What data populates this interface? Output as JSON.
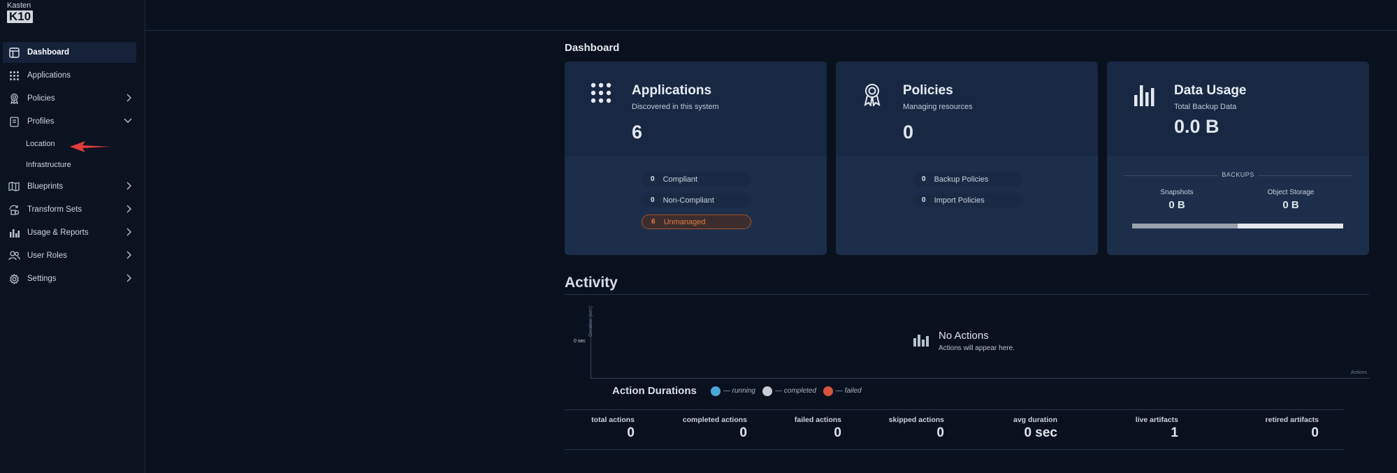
{
  "app": {
    "brand": "Kasten",
    "product": "K10"
  },
  "sidebar": {
    "items": [
      {
        "label": "Dashboard",
        "icon": "dashboard-icon",
        "active": true
      },
      {
        "label": "Applications",
        "icon": "grid-icon"
      },
      {
        "label": "Policies",
        "icon": "ribbon-icon",
        "chevron": "right"
      },
      {
        "label": "Profiles",
        "icon": "profile-icon",
        "chevron": "down"
      },
      {
        "label": "Blueprints",
        "icon": "map-icon",
        "chevron": "right"
      },
      {
        "label": "Transform Sets",
        "icon": "transform-icon",
        "chevron": "right"
      },
      {
        "label": "Usage & Reports",
        "icon": "bar-chart-icon",
        "chevron": "right"
      },
      {
        "label": "User Roles",
        "icon": "users-icon",
        "chevron": "right"
      },
      {
        "label": "Settings",
        "icon": "gear-icon",
        "chevron": "right"
      }
    ],
    "profiles_sub": [
      "Location",
      "Infrastructure"
    ]
  },
  "main": {
    "title": "Dashboard",
    "cards": {
      "applications": {
        "title": "Applications",
        "subtitle": "Discovered in this system",
        "value": "6",
        "pills": [
          {
            "n": "0",
            "label": "Compliant"
          },
          {
            "n": "0",
            "label": "Non-Compliant"
          },
          {
            "n": "6",
            "label": "Unmanaged"
          }
        ]
      },
      "policies": {
        "title": "Policies",
        "subtitle": "Managing resources",
        "value": "0",
        "pills": [
          {
            "n": "0",
            "label": "Backup Policies"
          },
          {
            "n": "0",
            "label": "Import Policies"
          }
        ]
      },
      "data_usage": {
        "title": "Data Usage",
        "subtitle": "Total Backup Data",
        "value": "0.0 B",
        "backups_label": "BACKUPS",
        "snapshots_label": "Snapshots",
        "snapshots_value": "0 B",
        "object_storage_label": "Object Storage",
        "object_storage_value": "0 B",
        "bar_fill_fraction": 0.5
      }
    },
    "activity": {
      "title": "Activity",
      "y_tick": "0 sec",
      "y_label": "Duration (sec)",
      "x_label": "Actions",
      "empty_title": "No Actions",
      "empty_subtitle": "Actions will appear here.",
      "legend_title": "Action Durations",
      "legend": [
        {
          "label": "— running",
          "color": "#4aa8d8"
        },
        {
          "label": "— completed",
          "color": "#c9cdd2"
        },
        {
          "label": "— failed",
          "color": "#d9533f"
        }
      ]
    },
    "stats": [
      {
        "label": "total actions",
        "value": "0"
      },
      {
        "label": "completed actions",
        "value": "0"
      },
      {
        "label": "failed actions",
        "value": "0"
      },
      {
        "label": "skipped actions",
        "value": "0"
      },
      {
        "label": "avg duration",
        "value": "0 sec"
      },
      {
        "label": "live artifacts",
        "value": "1"
      },
      {
        "label": "retired artifacts",
        "value": "0"
      }
    ]
  },
  "colors": {
    "accent_arrow": "#e23b3b",
    "warn": "#e67a3e"
  }
}
